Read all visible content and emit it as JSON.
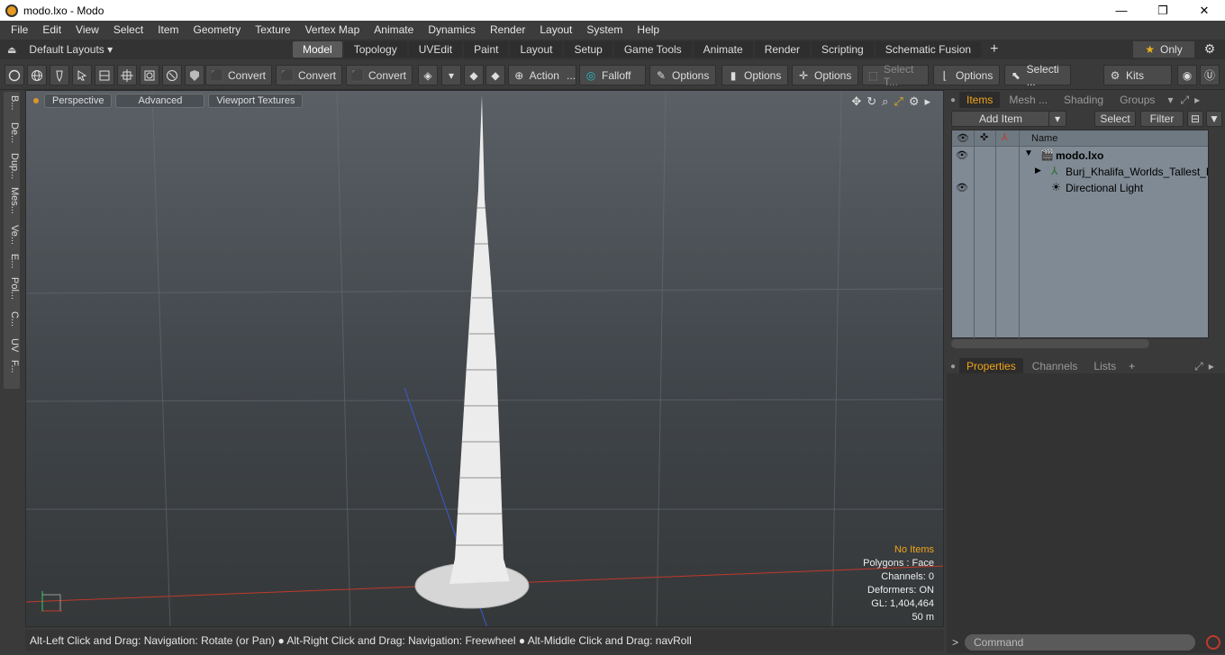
{
  "window": {
    "title": "modo.lxo - Modo",
    "controls": [
      "—",
      "❐",
      "✕"
    ]
  },
  "menubar": {
    "items": [
      "File",
      "Edit",
      "View",
      "Select",
      "Item",
      "Geometry",
      "Texture",
      "Vertex Map",
      "Animate",
      "Dynamics",
      "Render",
      "Layout",
      "System",
      "Help"
    ]
  },
  "layouts": {
    "label": "Default Layouts ▾",
    "tabs": [
      "Model",
      "Topology",
      "UVEdit",
      "Paint",
      "Layout",
      "Setup",
      "Game Tools",
      "Animate",
      "Render",
      "Scripting",
      "Schematic Fusion"
    ],
    "active_tab": "Model",
    "only_label": "Only"
  },
  "toolbar": {
    "convert1": "Convert",
    "convert2": "Convert",
    "convert3": "Convert",
    "action": "Action",
    "falloff": "Falloff",
    "options1": "Options",
    "options2": "Options",
    "options3": "Options",
    "select_t": "Select T...",
    "options4": "Options",
    "selecti": "Selecti ...",
    "kits": "Kits"
  },
  "lefttabs": [
    "B...",
    "De...",
    "Dup...",
    "Mes...",
    "Ve...",
    "E...",
    "Pol...",
    "C...",
    "UV",
    "F..."
  ],
  "viewport": {
    "mode": "Perspective",
    "shading": "Advanced",
    "textures": "Viewport Textures",
    "stats": {
      "warning": "No Items",
      "polygons": "Polygons : Face",
      "channels": "Channels: 0",
      "deformers": "Deformers: ON",
      "gl": "GL: 1,404,464",
      "scale": "50 m"
    }
  },
  "statusbar": {
    "text": "Alt-Left Click and Drag: Navigation: Rotate (or Pan) ● Alt-Right Click and Drag: Navigation: Freewheel ● Alt-Middle Click and Drag: navRoll"
  },
  "items_panel": {
    "tabs": [
      "Items",
      "Mesh ...",
      "Shading",
      "Groups"
    ],
    "add_item": "Add Item",
    "select": "Select",
    "filter": "Filter",
    "name_header": "Name",
    "rows": [
      {
        "label": "modo.lxo"
      },
      {
        "label": "Burj_Khalifa_Worlds_Tallest_B..."
      },
      {
        "label": "Directional Light"
      }
    ]
  },
  "props_panel": {
    "tabs": [
      "Properties",
      "Channels",
      "Lists"
    ]
  },
  "command": {
    "placeholder": "Command"
  },
  "colors": {
    "accent": "#f0a418",
    "viewport_top": "#5a6065",
    "tree_bg": "#7f8a94"
  }
}
